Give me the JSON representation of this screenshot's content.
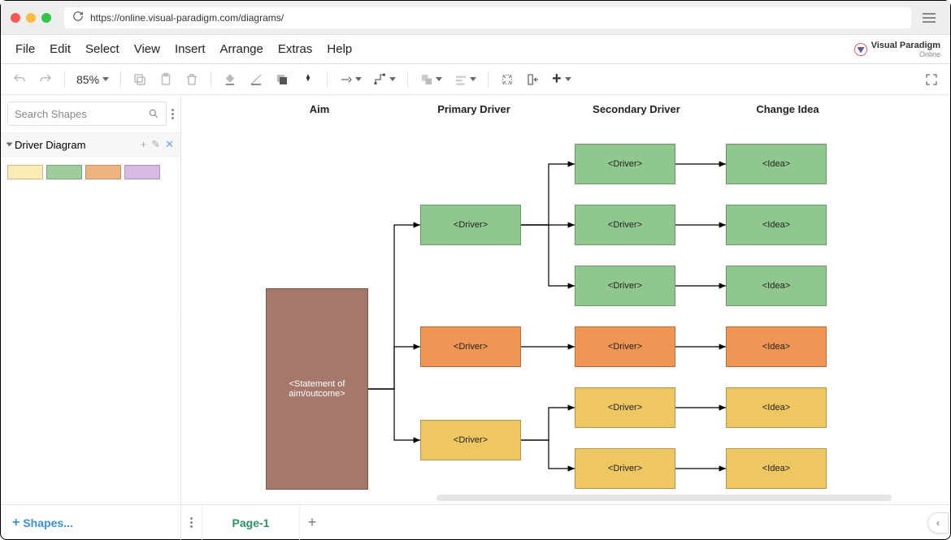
{
  "browser": {
    "url": "https://online.visual-paradigm.com/diagrams/"
  },
  "menu": {
    "file": "File",
    "edit": "Edit",
    "select": "Select",
    "view": "View",
    "insert": "Insert",
    "arrange": "Arrange",
    "extras": "Extras",
    "help": "Help",
    "logo_text": "Visual Paradigm",
    "logo_sub": "Online"
  },
  "toolbar": {
    "zoom": "85%"
  },
  "sidebar": {
    "search_placeholder": "Search Shapes",
    "palette_title": "Driver Diagram"
  },
  "canvas": {
    "headers": {
      "aim": "Aim",
      "primary": "Primary Driver",
      "secondary": "Secondary Driver",
      "change": "Change Idea"
    },
    "aim": "<Statement of aim/outcome>",
    "primary": {
      "p1": "<Driver>",
      "p2": "<Driver>",
      "p3": "<Driver>"
    },
    "secondary": {
      "s1": "<Driver>",
      "s2": "<Driver>",
      "s3": "<Driver>",
      "s4": "<Driver>",
      "s5": "<Driver>",
      "s6": "<Driver>"
    },
    "ideas": {
      "i1": "<Idea>",
      "i2": "<Idea>",
      "i3": "<Idea>",
      "i4": "<Idea>",
      "i5": "<Idea>",
      "i6": "<Idea>"
    }
  },
  "footer": {
    "shapes": "Shapes...",
    "page_tab": "Page-1"
  }
}
